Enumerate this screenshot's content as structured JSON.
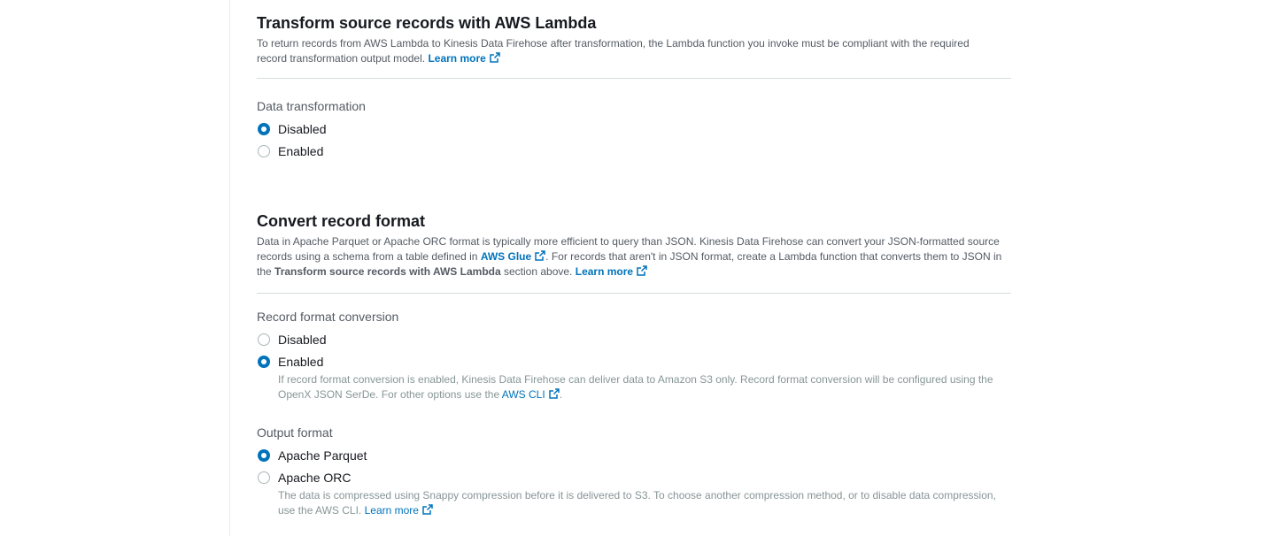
{
  "lambda_section": {
    "title": "Transform source records with AWS Lambda",
    "description": "To return records from AWS Lambda to Kinesis Data Firehose after transformation, the Lambda function you invoke must be compliant with the required record transformation output model.",
    "learn_more": "Learn more"
  },
  "data_transformation": {
    "label": "Data transformation",
    "options": [
      {
        "label": "Disabled",
        "checked": true
      },
      {
        "label": "Enabled",
        "checked": false
      }
    ]
  },
  "convert_section": {
    "title": "Convert record format",
    "desc_part1": "Data in Apache Parquet or Apache ORC format is typically more efficient to query than JSON. Kinesis Data Firehose can convert your JSON-formatted source records using a schema from a table defined in",
    "aws_glue_link": "AWS Glue",
    "desc_part2": ". For records that aren't in JSON format, create a Lambda function that converts them to JSON in the",
    "desc_bold": "Transform source records with AWS Lambda",
    "desc_part3": "section above.",
    "learn_more": "Learn more"
  },
  "record_format_conversion": {
    "label": "Record format conversion",
    "options": [
      {
        "label": "Disabled",
        "checked": false
      },
      {
        "label": "Enabled",
        "checked": true
      }
    ],
    "hint_part1": "If record format conversion is enabled, Kinesis Data Firehose can deliver data to Amazon S3 only. Record format conversion will be configured using the OpenX JSON SerDe. For other options use the",
    "hint_link": "AWS CLI",
    "hint_part2": "."
  },
  "output_format": {
    "label": "Output format",
    "options": [
      {
        "label": "Apache Parquet",
        "checked": true
      },
      {
        "label": "Apache ORC",
        "checked": false
      }
    ],
    "hint_part1": "The data is compressed using Snappy compression before it is delivered to S3. To choose another compression method, or to disable data compression, use the AWS CLI.",
    "hint_link": "Learn more"
  },
  "colors": {
    "link": "#0073bb",
    "radio_checked": "#0073bb",
    "text": "#16191f",
    "secondary_text": "#545b64",
    "hint_text": "#879596",
    "divider": "#d5dbdb"
  },
  "icons": [
    "external-link-icon"
  ]
}
